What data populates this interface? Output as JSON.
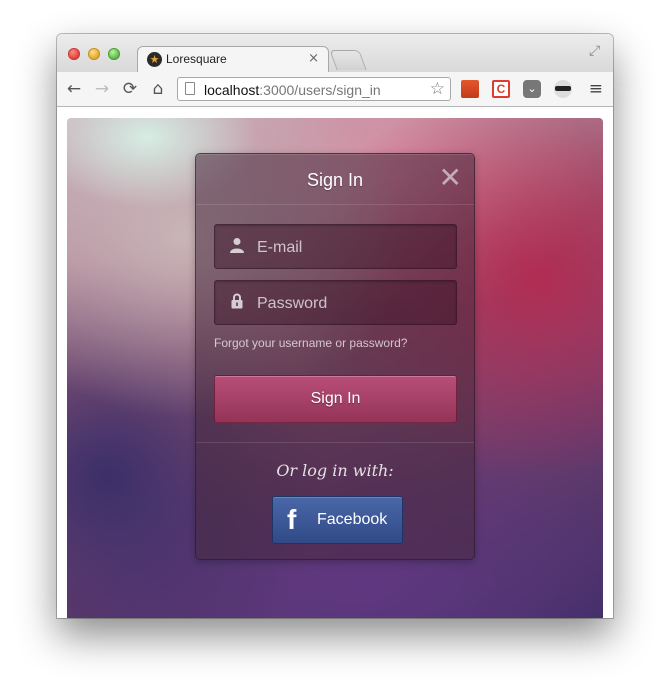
{
  "browser": {
    "tab_title": "Loresquare",
    "tab_close": "×",
    "url_host": "localhost",
    "url_path": ":3000/users/sign_in",
    "nav": {
      "back": "←",
      "forward": "→",
      "reload": "⟳",
      "home": "⌂"
    },
    "star": "☆",
    "menu": "≡",
    "extensions": [
      "bookmark-ext-icon",
      "c-ext-icon",
      "pocket-ext-icon",
      "mask-ext-icon"
    ]
  },
  "sign_in": {
    "title": "Sign In",
    "close": "✕",
    "email_placeholder": "E-mail",
    "password_placeholder": "Password",
    "forgot_link": "Forgot your username or password?",
    "submit_label": "Sign In",
    "alt_label": "Or log in with:",
    "facebook_label": "Facebook",
    "facebook_icon": "f"
  },
  "colors": {
    "primary_button": "#a8426a",
    "facebook_button": "#3b5998"
  }
}
